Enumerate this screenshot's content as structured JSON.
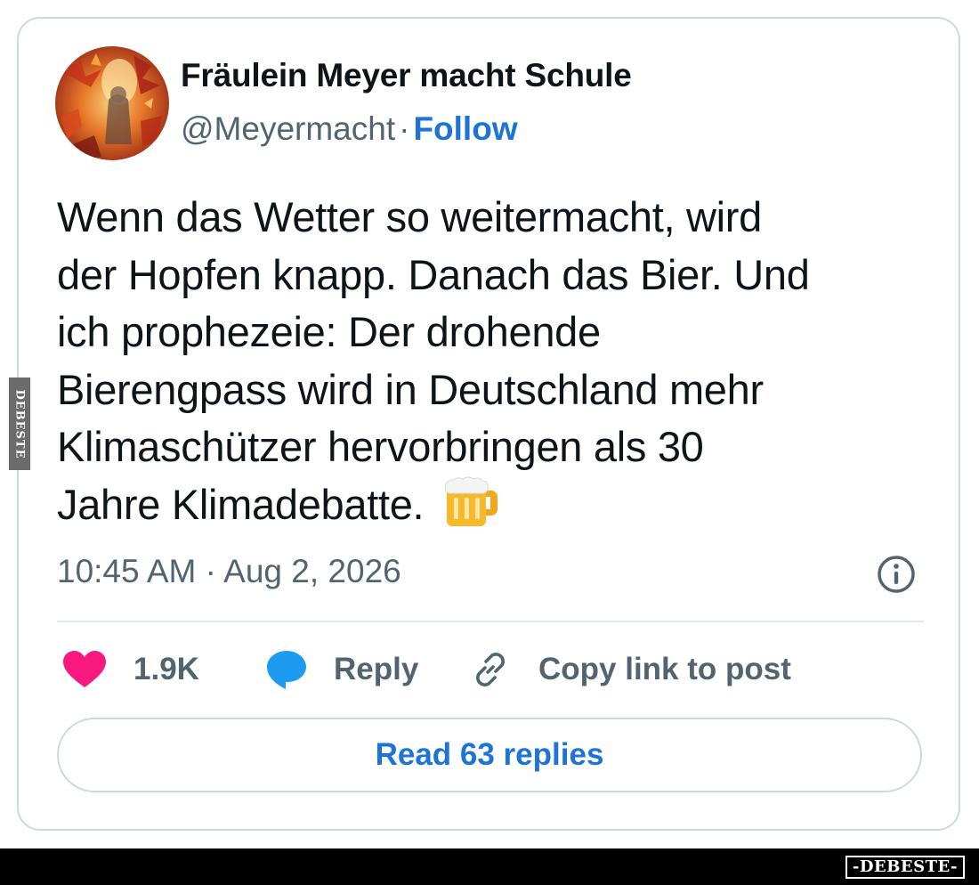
{
  "author": {
    "name": "Fräulein Meyer macht Schule",
    "handle": "@Meyermacht",
    "separator": "·",
    "follow_label": "Follow",
    "avatar_icon": "autumn-leaves-avatar"
  },
  "tweet": {
    "lines": [
      "Wenn das Wetter so weitermacht, wird",
      "der Hopfen knapp. Danach das Bier. Und",
      "ich prophezeie: Der drohende",
      "Bierengpass wird in Deutschland mehr",
      "Klimaschützer hervorbringen als 30",
      "Jahre Klimadebatte."
    ],
    "emoji_icon": "beer-mug-icon",
    "timestamp": "10:45 AM · Aug 2, 2026",
    "info_icon": "info-icon"
  },
  "actions": {
    "like_count": "1.9K",
    "reply_label": "Reply",
    "copy_link_label": "Copy link to post",
    "read_replies_label": "Read 63 replies"
  },
  "watermark": {
    "side_text": "DEBESTE",
    "bottom_text": "-DEBESTE-"
  },
  "colors": {
    "accent_blue": "#1d74d6",
    "like_pink": "#f91880",
    "reply_blue": "#1d9bf0",
    "text_primary": "#0f1419",
    "text_secondary": "#536471",
    "border": "#cfd9de"
  }
}
